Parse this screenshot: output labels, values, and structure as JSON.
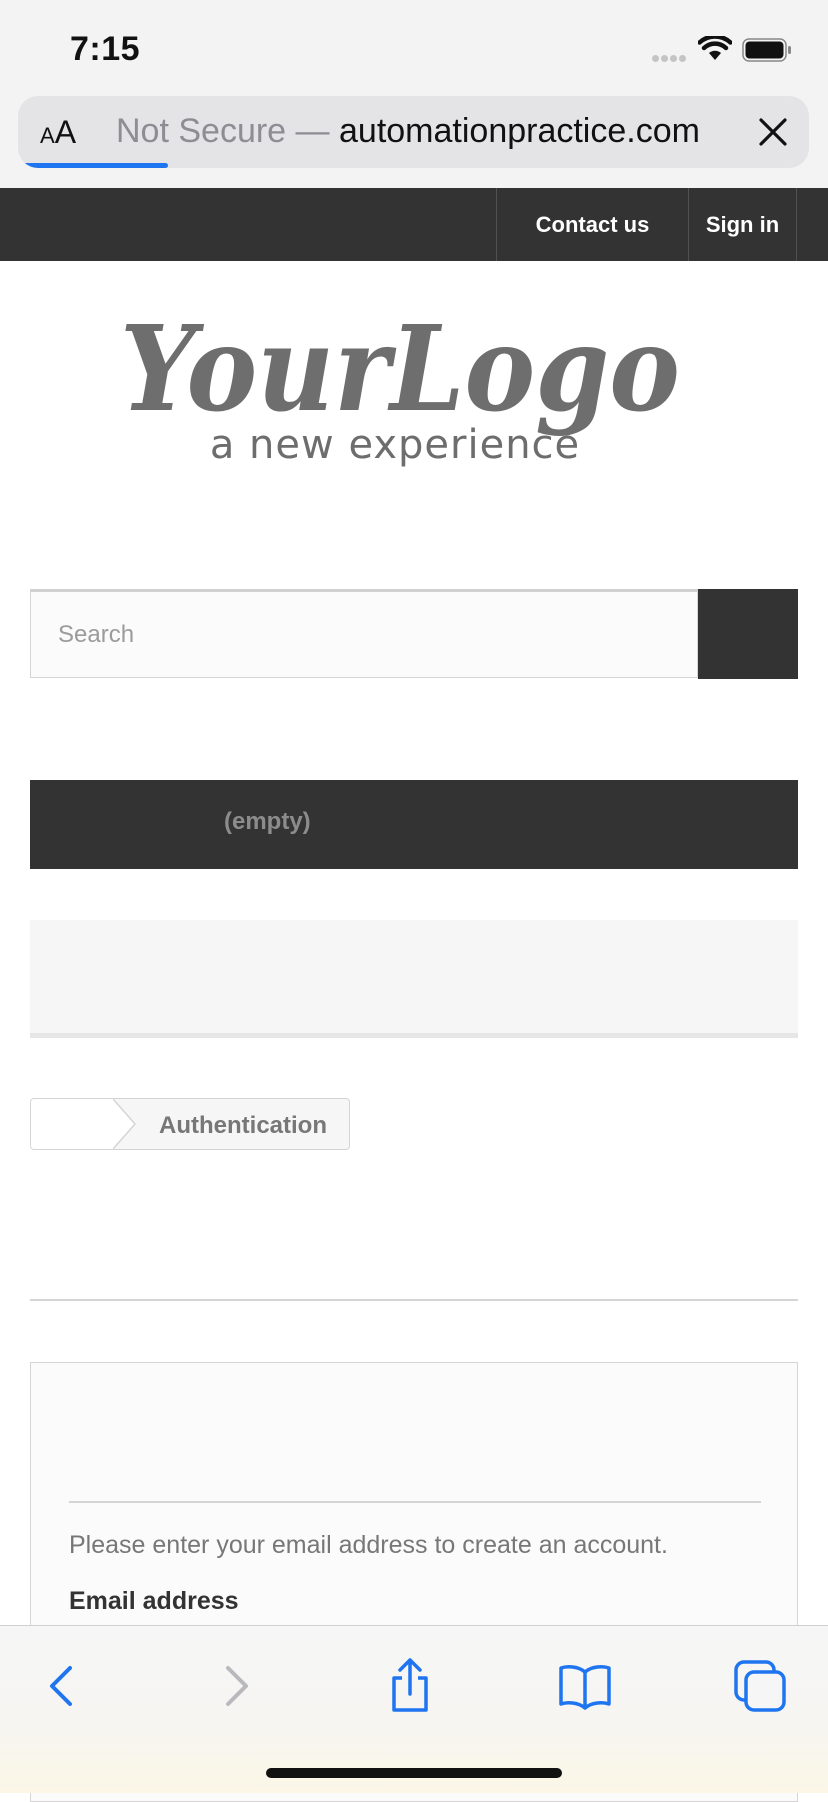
{
  "status_bar": {
    "time": "7:15"
  },
  "browser": {
    "reader_label_small": "A",
    "reader_label_large": "A",
    "security_label": "Not Secure",
    "separator": " — ",
    "host": "automationpractice.com",
    "icons": {
      "close": "close-x-icon"
    },
    "load_progress": 0.17
  },
  "nav": {
    "contact": "Contact us",
    "signin": "Sign in"
  },
  "logo": {
    "main": "YourLogo",
    "tagline": "a new experience"
  },
  "search": {
    "placeholder": "Search"
  },
  "cart": {
    "empty_label": "(empty)"
  },
  "breadcrumb": {
    "current": "Authentication"
  },
  "create_account": {
    "instruction": "Please enter your email address to create an account.",
    "email_label": "Email address"
  },
  "toolbar": {
    "icons": [
      "back-chevron-icon",
      "forward-chevron-icon",
      "share-icon",
      "bookmarks-book-icon",
      "tabs-icon"
    ]
  },
  "colors": {
    "accent": "#1f75f0",
    "nav_bg": "#333333"
  }
}
